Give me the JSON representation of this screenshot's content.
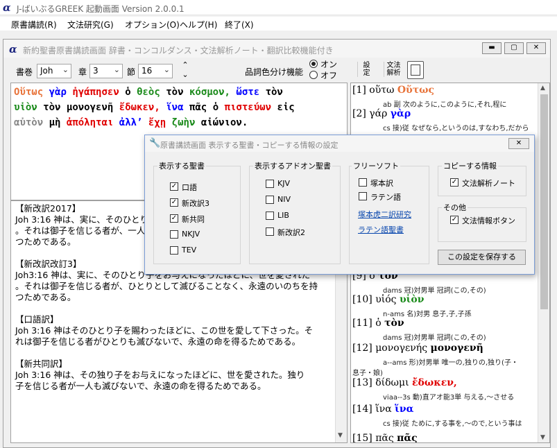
{
  "app": {
    "title": "J-ばいぶるGREEK  起動画面  Version 2.0.0.1"
  },
  "menu": [
    "原書講読(R)",
    "文法研究(G)",
    "オプション(O)",
    "ヘルプ(H)",
    "終了(X)"
  ],
  "inner_window": {
    "title": "新約聖書原書講読画面        辞書・コンコルダンス・文法解析ノート・翻訳比較機能付き"
  },
  "toolbar": {
    "book_label": "書巻",
    "book_value": "Joh",
    "chapter_label": "章",
    "chapter_value": "3",
    "verse_label": "節",
    "verse_value": "16",
    "pos_label": "品詞色分け機能",
    "radio_on": "オン",
    "radio_off": "オフ",
    "settings_btn": [
      "設",
      "定"
    ],
    "grammar_btn": [
      "文法",
      "解析"
    ]
  },
  "greek_text": [
    [
      [
        "Οὕτως",
        "orange"
      ],
      [
        "γὰρ",
        "blue"
      ],
      [
        "ἠγάπησεν",
        "red"
      ],
      [
        "ὁ",
        "black"
      ],
      [
        "θεὸς",
        "green"
      ],
      [
        "τὸν",
        "black"
      ],
      [
        "κόσμον,",
        "green"
      ],
      [
        "ὥστε",
        "blue"
      ],
      [
        "τὸν",
        "black"
      ]
    ],
    [
      [
        "υἱὸν",
        "green"
      ],
      [
        "τὸν",
        "black"
      ],
      [
        "μονογενῆ",
        "black"
      ],
      [
        "ἔδωκεν,",
        "red"
      ],
      [
        "ἵνα",
        "blue"
      ],
      [
        "πᾶς",
        "black"
      ],
      [
        "ὁ",
        "black"
      ],
      [
        "πιστεύων",
        "red"
      ],
      [
        "εἰς",
        "black"
      ]
    ],
    [
      [
        "αὐτὸν",
        "gray"
      ],
      [
        "μὴ",
        "black"
      ],
      [
        "ἀπόληται",
        "red"
      ],
      [
        "ἀλλ’",
        "blue"
      ],
      [
        "ἔχῃ",
        "red"
      ],
      [
        "ζωὴν",
        "green"
      ],
      [
        "αἰώνιον.",
        "black"
      ]
    ]
  ],
  "translations": [
    "【新改訳2017】\nJoh 3:16 神は、実に、そのひとり子をお与えになったほどに世を愛された\n。それは御子を信じる者が、一人として滅びることなく、永遠のいのちを持\nつためである。",
    "【新改訳改訂3】\nJoh3:16 神は、実に、そのひとり子をお与えになったほどに、世を愛された\n。それは御子を信じる者が、ひとりとして滅びることなく、永遠のいのちを持\nつためである。",
    "【口語訳】\nJoh 3:16 神はそのひとり子を賜わったほどに、この世を愛して下さった。そ\nれは御子を信じる者がひとりも滅びないで、永遠の命を得るためである。",
    "【新共同訳】\nJoh 3:16 神は、その独り子をお与えになったほどに、世を愛された。独り\n子を信じる者が一人も滅びないで、永遠の命を得るためである。"
  ],
  "words": [
    {
      "n": "[1]",
      "lemma": "οὕτω",
      "form": "Οὕτως",
      "color": "orange",
      "detail": "ab 副 次のように,このように,それ,程に"
    },
    {
      "n": "[2]",
      "lemma": "γάρ",
      "form": "γὰρ",
      "color": "blue",
      "detail": "cs 接)従 なぜなら,というのは,すなわち,だから"
    },
    {
      "n": "[9]",
      "lemma": "ὁ",
      "form": "τὸν",
      "color": "black",
      "detail": "dams 冠)対男単 冠詞(この,その)"
    },
    {
      "n": "[10]",
      "lemma": "υἱός",
      "form": "υἱὸν",
      "color": "green",
      "detail": "n-ams 名)対男 息子,子,子孫"
    },
    {
      "n": "[11]",
      "lemma": "ὁ",
      "form": "τὸν",
      "color": "black",
      "detail": "dams 冠)対男単 冠詞(この,その)"
    },
    {
      "n": "[12]",
      "lemma": "μονογενής",
      "form": "μονογενῆ",
      "color": "black",
      "detail": "a--ams 形)対男単 唯一の,独りの,独り(子・",
      "detail2": "息子・娘)"
    },
    {
      "n": "[13]",
      "lemma": "δίδωμι",
      "form": "ἔδωκεν,",
      "color": "red",
      "detail": "viaa--3s 動)直アオ能3単 与える,～させる"
    },
    {
      "n": "[14]",
      "lemma": "ἵνα",
      "form": "ἵνα",
      "color": "blue",
      "detail": "cs 接)従 ために,する事を,～ので,という事は"
    },
    {
      "n": "[15]",
      "lemma": "πᾶς",
      "form": "πᾶς",
      "color": "black",
      "detail": ""
    }
  ],
  "dialog": {
    "title": "原書講読画面  表示する聖書・コピーする情報の設定",
    "groups": {
      "bibles": {
        "title": "表示する聖書",
        "items": [
          {
            "label": "口語",
            "checked": true
          },
          {
            "label": "新改訳3",
            "checked": true
          },
          {
            "label": "新共同",
            "checked": true
          },
          {
            "label": "NKJV",
            "checked": false
          },
          {
            "label": "TEV",
            "checked": false
          }
        ]
      },
      "addon": {
        "title": "表示するアドオン聖書",
        "items": [
          {
            "label": "KJV",
            "checked": false
          },
          {
            "label": "NIV",
            "checked": false
          },
          {
            "label": "LIB",
            "checked": false
          },
          {
            "label": "新改訳2",
            "checked": false
          }
        ]
      },
      "free": {
        "title": "フリーソフト",
        "items": [
          {
            "label": "塚本訳",
            "checked": false
          },
          {
            "label": "ラテン語",
            "checked": false
          }
        ],
        "links": [
          "塚本虎二訳研究",
          "ラテン語聖書"
        ]
      },
      "copy": {
        "title": "コピーする情報",
        "items": [
          {
            "label": "文法解析ノート",
            "checked": true
          }
        ]
      },
      "other": {
        "title": "その他",
        "items": [
          {
            "label": "文法情報ボタン",
            "checked": true
          }
        ]
      }
    },
    "save_button": "この設定を保存する"
  }
}
